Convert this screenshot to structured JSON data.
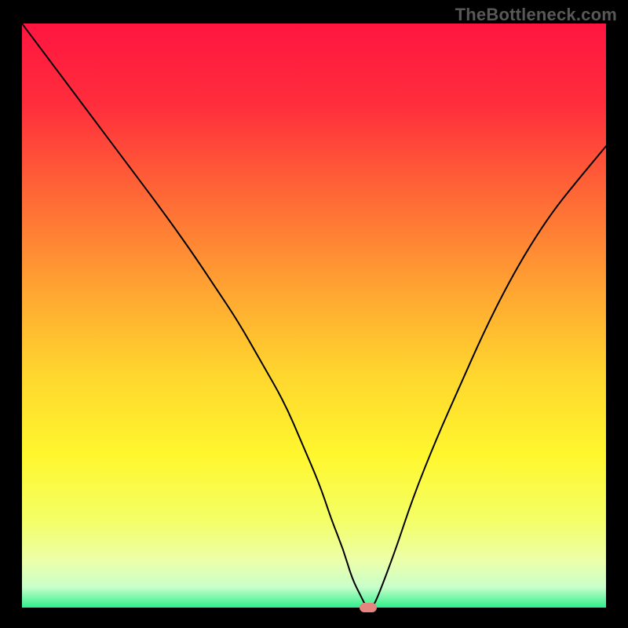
{
  "watermark": "TheBottleneck.com",
  "chart_data": {
    "type": "line",
    "title": "",
    "xlabel": "",
    "ylabel": "",
    "xlim": [
      0,
      100
    ],
    "ylim": [
      0,
      100
    ],
    "x": [
      0,
      6,
      12,
      18,
      24,
      29,
      33,
      37,
      41,
      45,
      48,
      51,
      53,
      55,
      56.5,
      58,
      59,
      60,
      61,
      64,
      67,
      71,
      75,
      79,
      83,
      87,
      91,
      95,
      100
    ],
    "values": [
      100,
      92,
      84,
      76,
      68,
      61,
      55,
      49,
      42,
      35,
      28,
      21,
      15,
      10,
      5,
      2,
      0,
      0,
      2,
      10,
      19,
      29,
      38,
      47,
      55,
      62,
      68,
      73,
      79
    ],
    "marker": {
      "x": 59.3,
      "y": 0
    },
    "gradient_stops": [
      {
        "pct": 0,
        "color": "#ff1540"
      },
      {
        "pct": 14,
        "color": "#ff2e3c"
      },
      {
        "pct": 30,
        "color": "#ff6a36"
      },
      {
        "pct": 46,
        "color": "#ffa632"
      },
      {
        "pct": 60,
        "color": "#ffd62e"
      },
      {
        "pct": 74,
        "color": "#fff72e"
      },
      {
        "pct": 85,
        "color": "#f4ff66"
      },
      {
        "pct": 92,
        "color": "#ecffaa"
      },
      {
        "pct": 96.5,
        "color": "#c8ffca"
      },
      {
        "pct": 100,
        "color": "#2fef8b"
      }
    ]
  }
}
